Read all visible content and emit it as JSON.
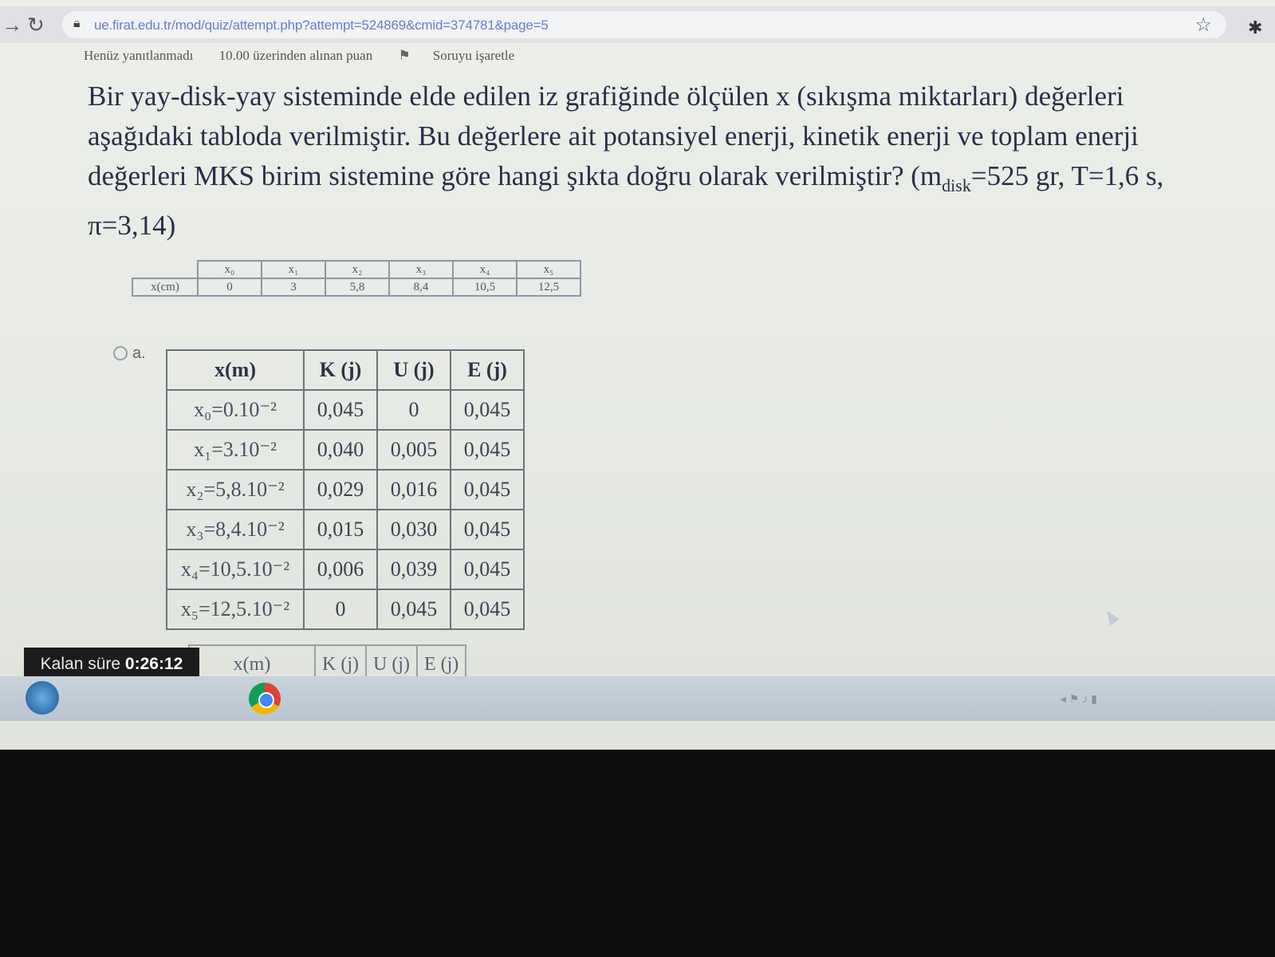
{
  "browser": {
    "url": "ue.firat.edu.tr/mod/quiz/attempt.php?attempt=524869&cmid=374781&page=5"
  },
  "quiz_info": {
    "status": "Henüz yanıtlanmadı",
    "points": "10.00 üzerinden alınan puan",
    "flag": "Soruyu işaretle"
  },
  "question": {
    "text_before_sub": "Bir yay-disk-yay sisteminde elde edilen iz grafiğinde ölçülen x (sıkışma miktarları) değerleri aşağıdaki tabloda verilmiştir. Bu değerlere ait potansiyel enerji, kinetik enerji ve toplam enerji değerleri MKS birim sistemine göre hangi şıkta doğru olarak verilmiştir? (m",
    "sub": "disk",
    "text_after_sub": "=525 gr, T=1,6 s, π=3,14)"
  },
  "data_table": {
    "row_label": "x(cm)",
    "headers": [
      "x₀",
      "x₁",
      "x₂",
      "x₃",
      "x₄",
      "x₅"
    ],
    "values": [
      "0",
      "3",
      "5,8",
      "8,4",
      "10,5",
      "12,5"
    ]
  },
  "option_a": {
    "label": "a.",
    "headers": [
      "x(m)",
      "K (j)",
      "U (j)",
      "E (j)"
    ],
    "rows": [
      [
        "x₀=0.10⁻²",
        "0,045",
        "0",
        "0,045"
      ],
      [
        "x₁=3.10⁻²",
        "0,040",
        "0,005",
        "0,045"
      ],
      [
        "x₂=5,8.10⁻²",
        "0,029",
        "0,016",
        "0,045"
      ],
      [
        "x₃=8,4.10⁻²",
        "0,015",
        "0,030",
        "0,045"
      ],
      [
        "x₄=10,5.10⁻²",
        "0,006",
        "0,039",
        "0,045"
      ],
      [
        "x₅=12,5.10⁻²",
        "0",
        "0,045",
        "0,045"
      ]
    ]
  },
  "option_b": {
    "headers": [
      "x(m)",
      "K (j)",
      "U (j)",
      "E (j)"
    ]
  },
  "timer": {
    "label": "Kalan süre",
    "value": "0:26:12"
  }
}
